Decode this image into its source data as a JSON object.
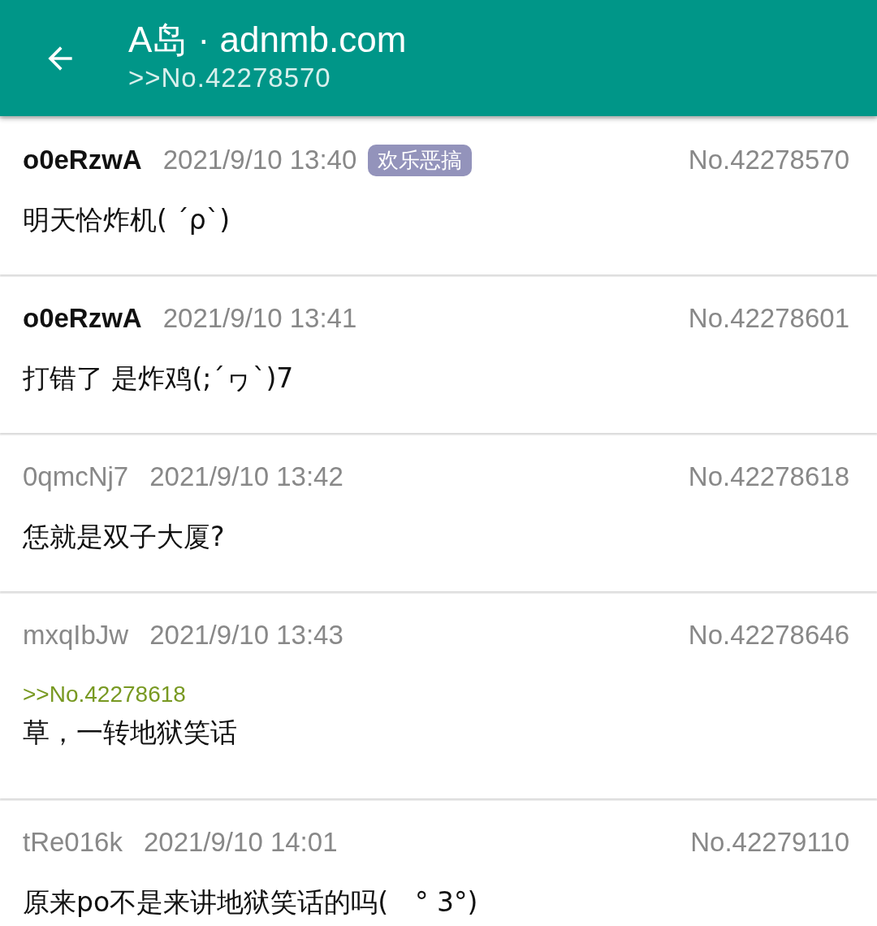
{
  "app_bar": {
    "title": "A岛 · adnmb.com",
    "subtitle": ">>No.42278570"
  },
  "posts": [
    {
      "uid": "o0eRzwA",
      "is_po": true,
      "time": "2021/9/10 13:40",
      "tag": "欢乐恶搞",
      "number": "No.42278570",
      "content": "明天恰炸机( ´ρ`)"
    },
    {
      "uid": "o0eRzwA",
      "is_po": true,
      "time": "2021/9/10 13:41",
      "number": "No.42278601",
      "content": "打错了 是炸鸡(;´ヮ`)7"
    },
    {
      "uid": "0qmcNj7",
      "is_po": false,
      "time": "2021/9/10 13:42",
      "number": "No.42278618",
      "content": "恁就是双子大厦?"
    },
    {
      "uid": "mxqIbJw",
      "is_po": false,
      "time": "2021/9/10 13:43",
      "number": "No.42278646",
      "quote": ">>No.42278618",
      "content": "草，一转地狱笑话"
    },
    {
      "uid": "tRe016k",
      "is_po": false,
      "time": "2021/9/10 14:01",
      "number": "No.42279110",
      "content": "原来po不是来讲地狱笑话的吗(　° 3°)"
    }
  ]
}
